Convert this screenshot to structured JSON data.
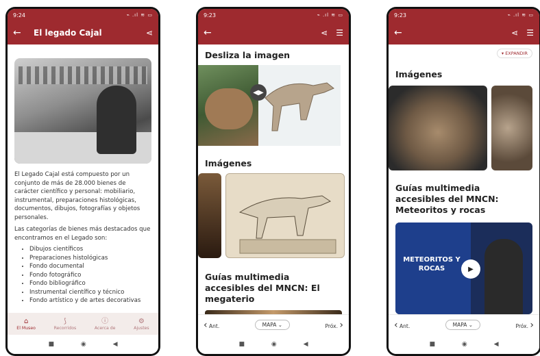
{
  "phone1": {
    "status": {
      "time": "9:24",
      "icons": "⌁ .ıl ≋ ▭"
    },
    "appbar": {
      "title": "El legado Cajal"
    },
    "paragraphs": [
      "El Legado Cajal está compuesto por un conjunto de más de 28.000 bienes de carácter científico y personal: mobiliario, instrumental, preparaciones histológicas, documentos, dibujos, fotografías y objetos personales.",
      "Las categorías de bienes más destacados que encontramos en el Legado son:"
    ],
    "list": [
      "Dibujos científicos",
      "Preparaciones histológicas",
      "Fondo documental",
      "Fondo fotográfico",
      "Fondo bibliográfico",
      "Instrumental científico y técnico",
      "Fondo artístico y de artes decorativas"
    ],
    "bottom_nav": [
      {
        "label": "El Museo",
        "icon": "home-icon"
      },
      {
        "label": "Recorridos",
        "icon": "route-icon"
      },
      {
        "label": "Acerca de",
        "icon": "info-icon"
      },
      {
        "label": "Ajustes",
        "icon": "gear-icon"
      }
    ]
  },
  "phone2": {
    "status": {
      "time": "9:23",
      "icons": "⌁ .ıl ≋ ▭"
    },
    "section1": "Desliza la imagen",
    "section2": "Imágenes",
    "section3": "Guías multimedia accesibles del MNCN: El megaterio",
    "pager": {
      "prev": "Ant.",
      "map": "MAPA",
      "next": "Próx."
    }
  },
  "phone3": {
    "status": {
      "time": "9:23",
      "icons": "⌁ .ıl ≋ ▭"
    },
    "expand": "EXPANDIR",
    "section1": "Imágenes",
    "section2": "Guías multimedia accesibles del MNCN: Meteoritos y rocas",
    "video_text": "METEORITOS Y ROCAS",
    "pager": {
      "prev": "Ant.",
      "map": "MAPA",
      "next": "Próx."
    }
  },
  "colors": {
    "brand": "#9e2a2f"
  }
}
